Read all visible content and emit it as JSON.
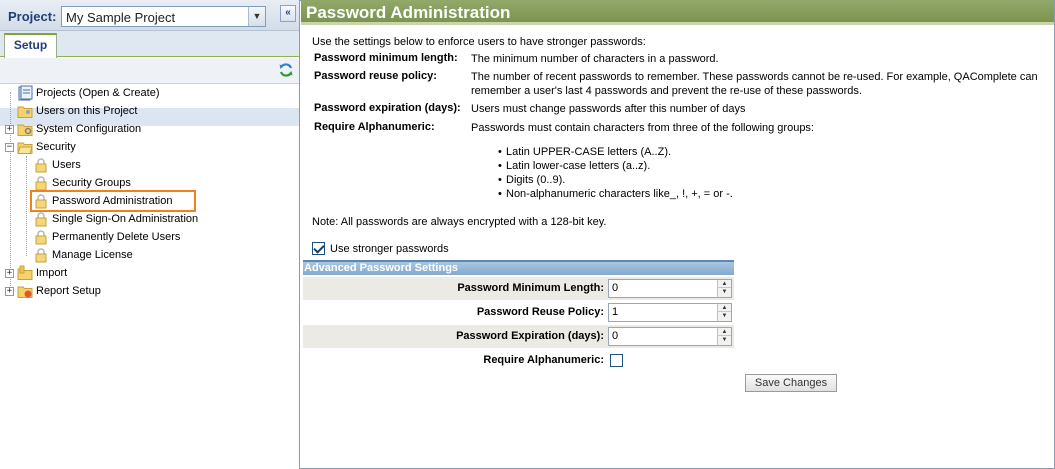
{
  "sidebar": {
    "project_label": "Project:",
    "project_value": "My Sample Project",
    "tabs": [
      {
        "label": "Setup"
      }
    ],
    "tree": [
      {
        "label": "Projects (Open & Create)"
      },
      {
        "label": "Users on this Project"
      },
      {
        "label": "System Configuration"
      },
      {
        "label": "Security"
      },
      {
        "label": "Users"
      },
      {
        "label": "Security Groups"
      },
      {
        "label": "Password Administration"
      },
      {
        "label": "Single Sign-On Administration"
      },
      {
        "label": "Permanently Delete Users"
      },
      {
        "label": "Manage License"
      },
      {
        "label": "Import"
      },
      {
        "label": "Report Setup"
      }
    ]
  },
  "main": {
    "title": "Password Administration",
    "intro": "Use the settings below to enforce users to have stronger passwords:",
    "definitions": [
      {
        "label": "Password minimum length:",
        "text": "The minimum number of characters in a password."
      },
      {
        "label": "Password reuse policy:",
        "text": "The number of recent passwords to remember. These passwords cannot be re-used. For example, QAComplete can remember a user's last 4 passwords and prevent the re-use of these passwords."
      },
      {
        "label": "Password expiration (days):",
        "text": "Users must change passwords after this number of days"
      },
      {
        "label": "Require Alphanumeric:",
        "text": "Passwords must contain characters from three of the following groups:"
      }
    ],
    "groups": [
      "Latin UPPER-CASE letters (A..Z).",
      "Latin lower-case letters (a..z).",
      "Digits (0..9).",
      "Non-alphanumeric characters like_, !, +, = or -."
    ],
    "note": "Note: All passwords are always encrypted with a 128-bit key.",
    "use_stronger_label": "Use stronger passwords",
    "use_stronger_checked": true,
    "advanced": {
      "header": "Advanced Password Settings",
      "min_length_label": "Password Minimum Length:",
      "min_length_value": "0",
      "reuse_label": "Password Reuse Policy:",
      "reuse_value": "1",
      "expiration_label": "Password Expiration (days):",
      "expiration_value": "0",
      "alnum_label": "Require Alphanumeric:",
      "alnum_checked": false
    },
    "save_label": "Save Changes"
  },
  "colors": {
    "title_bar": "#7f9753",
    "selection_outline": "#f0821e",
    "section_header": "#8fb0d2"
  }
}
